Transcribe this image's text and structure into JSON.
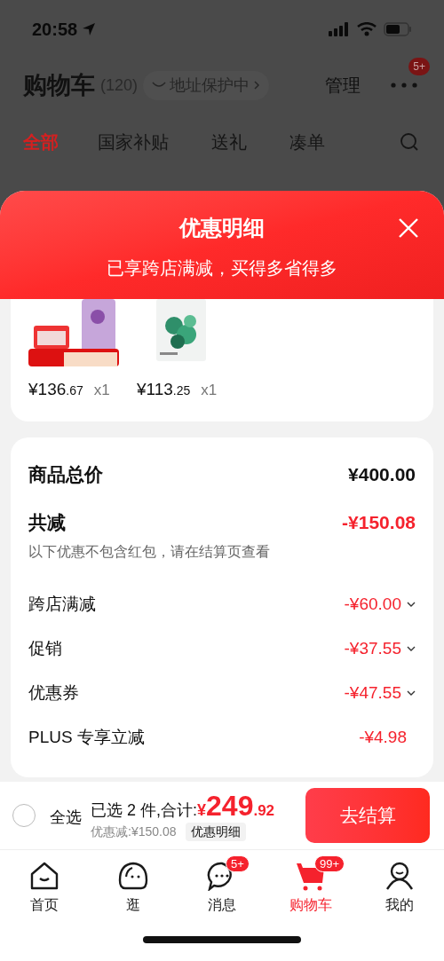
{
  "status_bar": {
    "time": "20:58"
  },
  "header": {
    "title": "购物车",
    "count": "(120)",
    "address": "地址保护中",
    "action": "管理",
    "more_badge": "5+"
  },
  "tabs": [
    {
      "label": "全部",
      "selected": true
    },
    {
      "label": "国家补贴",
      "selected": false
    },
    {
      "label": "送礼",
      "selected": false
    },
    {
      "label": "凑单",
      "selected": false
    }
  ],
  "sheet": {
    "title": "优惠明细",
    "subtitle": "已享跨店满减，买得多省得多"
  },
  "products": [
    {
      "kind": "picture",
      "price": "¥136",
      "price_decimal": ".67",
      "quantity": "x1"
    },
    {
      "kind": "picture",
      "price": "¥113",
      "price_decimal": ".25",
      "quantity": "x1"
    }
  ],
  "summary": [
    {
      "kind": "total",
      "label": "商品总价",
      "value": "¥400.00"
    },
    {
      "kind": "reduction",
      "label": "共减",
      "value": "-¥150.08",
      "note": "以下优惠不包含红包，请在结算页查看"
    },
    {
      "kind": "item",
      "label": "跨店满减",
      "value": "-¥60.00",
      "expandable": true
    },
    {
      "kind": "item",
      "label": "促销",
      "value": "-¥37.55",
      "expandable": true
    },
    {
      "kind": "item",
      "label": "优惠券",
      "value": "-¥47.55",
      "expandable": true
    },
    {
      "kind": "item",
      "label": "PLUS 专享立减",
      "value": "-¥4.98",
      "expandable": false
    }
  ],
  "footer": {
    "select_all": {
      "label": "全选",
      "checked": false
    },
    "selected_text": "已选 2 件,合计:",
    "currency": "¥",
    "amount": "249",
    "amount_decimal": ".92",
    "discount": "优惠减:¥150.08",
    "detail_button": "优惠明细",
    "checkout": "去结算"
  },
  "tab_bar": [
    {
      "kind": "home",
      "label": "首页",
      "selected": false
    },
    {
      "kind": "browse",
      "label": "逛",
      "selected": false
    },
    {
      "kind": "messages",
      "label": "消息",
      "selected": false,
      "badge": "5+"
    },
    {
      "kind": "cart",
      "label": "购物车",
      "selected": true,
      "badge": "99+"
    },
    {
      "kind": "profile",
      "label": "我的",
      "selected": false
    }
  ]
}
